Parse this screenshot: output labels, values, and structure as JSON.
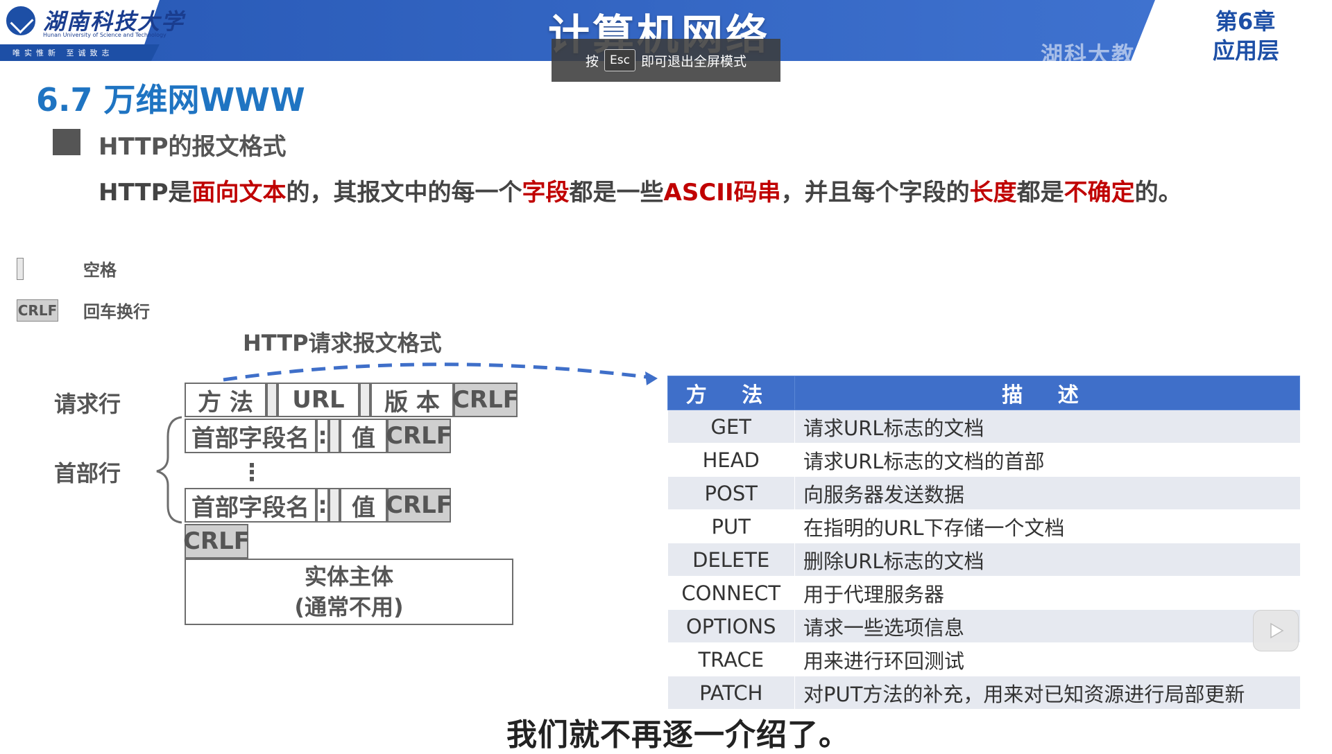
{
  "header": {
    "university_name": "湖南科技大学",
    "university_name_en": "Hunan University of Science and Technology",
    "motto": "唯实惟新   至诚致志",
    "course_title": "计算机网络",
    "chapter_number": "第6章",
    "chapter_name": "应用层",
    "watermark": "湖科大教书匠"
  },
  "fullscreen_toast": {
    "prefix": "按",
    "key": "Esc",
    "suffix": "即可退出全屏模式"
  },
  "slide": {
    "section_title": "6.7 万维网WWW",
    "bullet_heading": "HTTP的报文格式",
    "description_parts": [
      {
        "text": "HTTP是",
        "highlight": false
      },
      {
        "text": "面向文本",
        "highlight": true
      },
      {
        "text": "的，其报文中的每一个",
        "highlight": false
      },
      {
        "text": "字段",
        "highlight": true
      },
      {
        "text": "都是一些",
        "highlight": false
      },
      {
        "text": "ASCII码串",
        "highlight": true
      },
      {
        "text": "，并且每个字段的",
        "highlight": false
      },
      {
        "text": "长度",
        "highlight": true
      },
      {
        "text": "都是",
        "highlight": false
      },
      {
        "text": "不确定",
        "highlight": true
      },
      {
        "text": "的。",
        "highlight": false
      }
    ],
    "highlight_color": "#c00000",
    "legend": {
      "space_label": "空格",
      "crlf_box": "CRLF",
      "crlf_label": "回车换行"
    }
  },
  "diagram": {
    "title": "HTTP请求报文格式",
    "request_line_label": "请求行",
    "header_line_label": "首部行",
    "request_line": {
      "method": "方 法",
      "url": "URL",
      "version": "版 本",
      "crlf": "CRLF"
    },
    "header_row_1": {
      "name": "首部字段名",
      "colon": ":",
      "value": "值",
      "crlf": "CRLF"
    },
    "vdots": "⋮",
    "header_row_2": {
      "name": "首部字段名",
      "colon": ":",
      "value": "值",
      "crlf": "CRLF"
    },
    "blank_line_crlf": "CRLF",
    "body_line1": "实体主体",
    "body_line2": "(通常不用)"
  },
  "methods_table": {
    "header_method": "方 法",
    "header_desc": "描 述",
    "header_color": "#3f6fc9",
    "rows": [
      {
        "method": "GET",
        "desc": "请求URL标志的文档"
      },
      {
        "method": "HEAD",
        "desc": "请求URL标志的文档的首部"
      },
      {
        "method": "POST",
        "desc": "向服务器发送数据"
      },
      {
        "method": "PUT",
        "desc": "在指明的URL下存储一个文档"
      },
      {
        "method": "DELETE",
        "desc": "删除URL标志的文档"
      },
      {
        "method": "CONNECT",
        "desc": "用于代理服务器"
      },
      {
        "method": "OPTIONS",
        "desc": "请求一些选项信息"
      },
      {
        "method": "TRACE",
        "desc": "用来进行环回测试"
      },
      {
        "method": "PATCH",
        "desc": "对PUT方法的补充，用来对已知资源进行局部更新"
      }
    ]
  },
  "subtitle": "我们就不再逐一介绍了。",
  "icons": {
    "play": "play-icon",
    "logo": "university-logo-icon"
  }
}
